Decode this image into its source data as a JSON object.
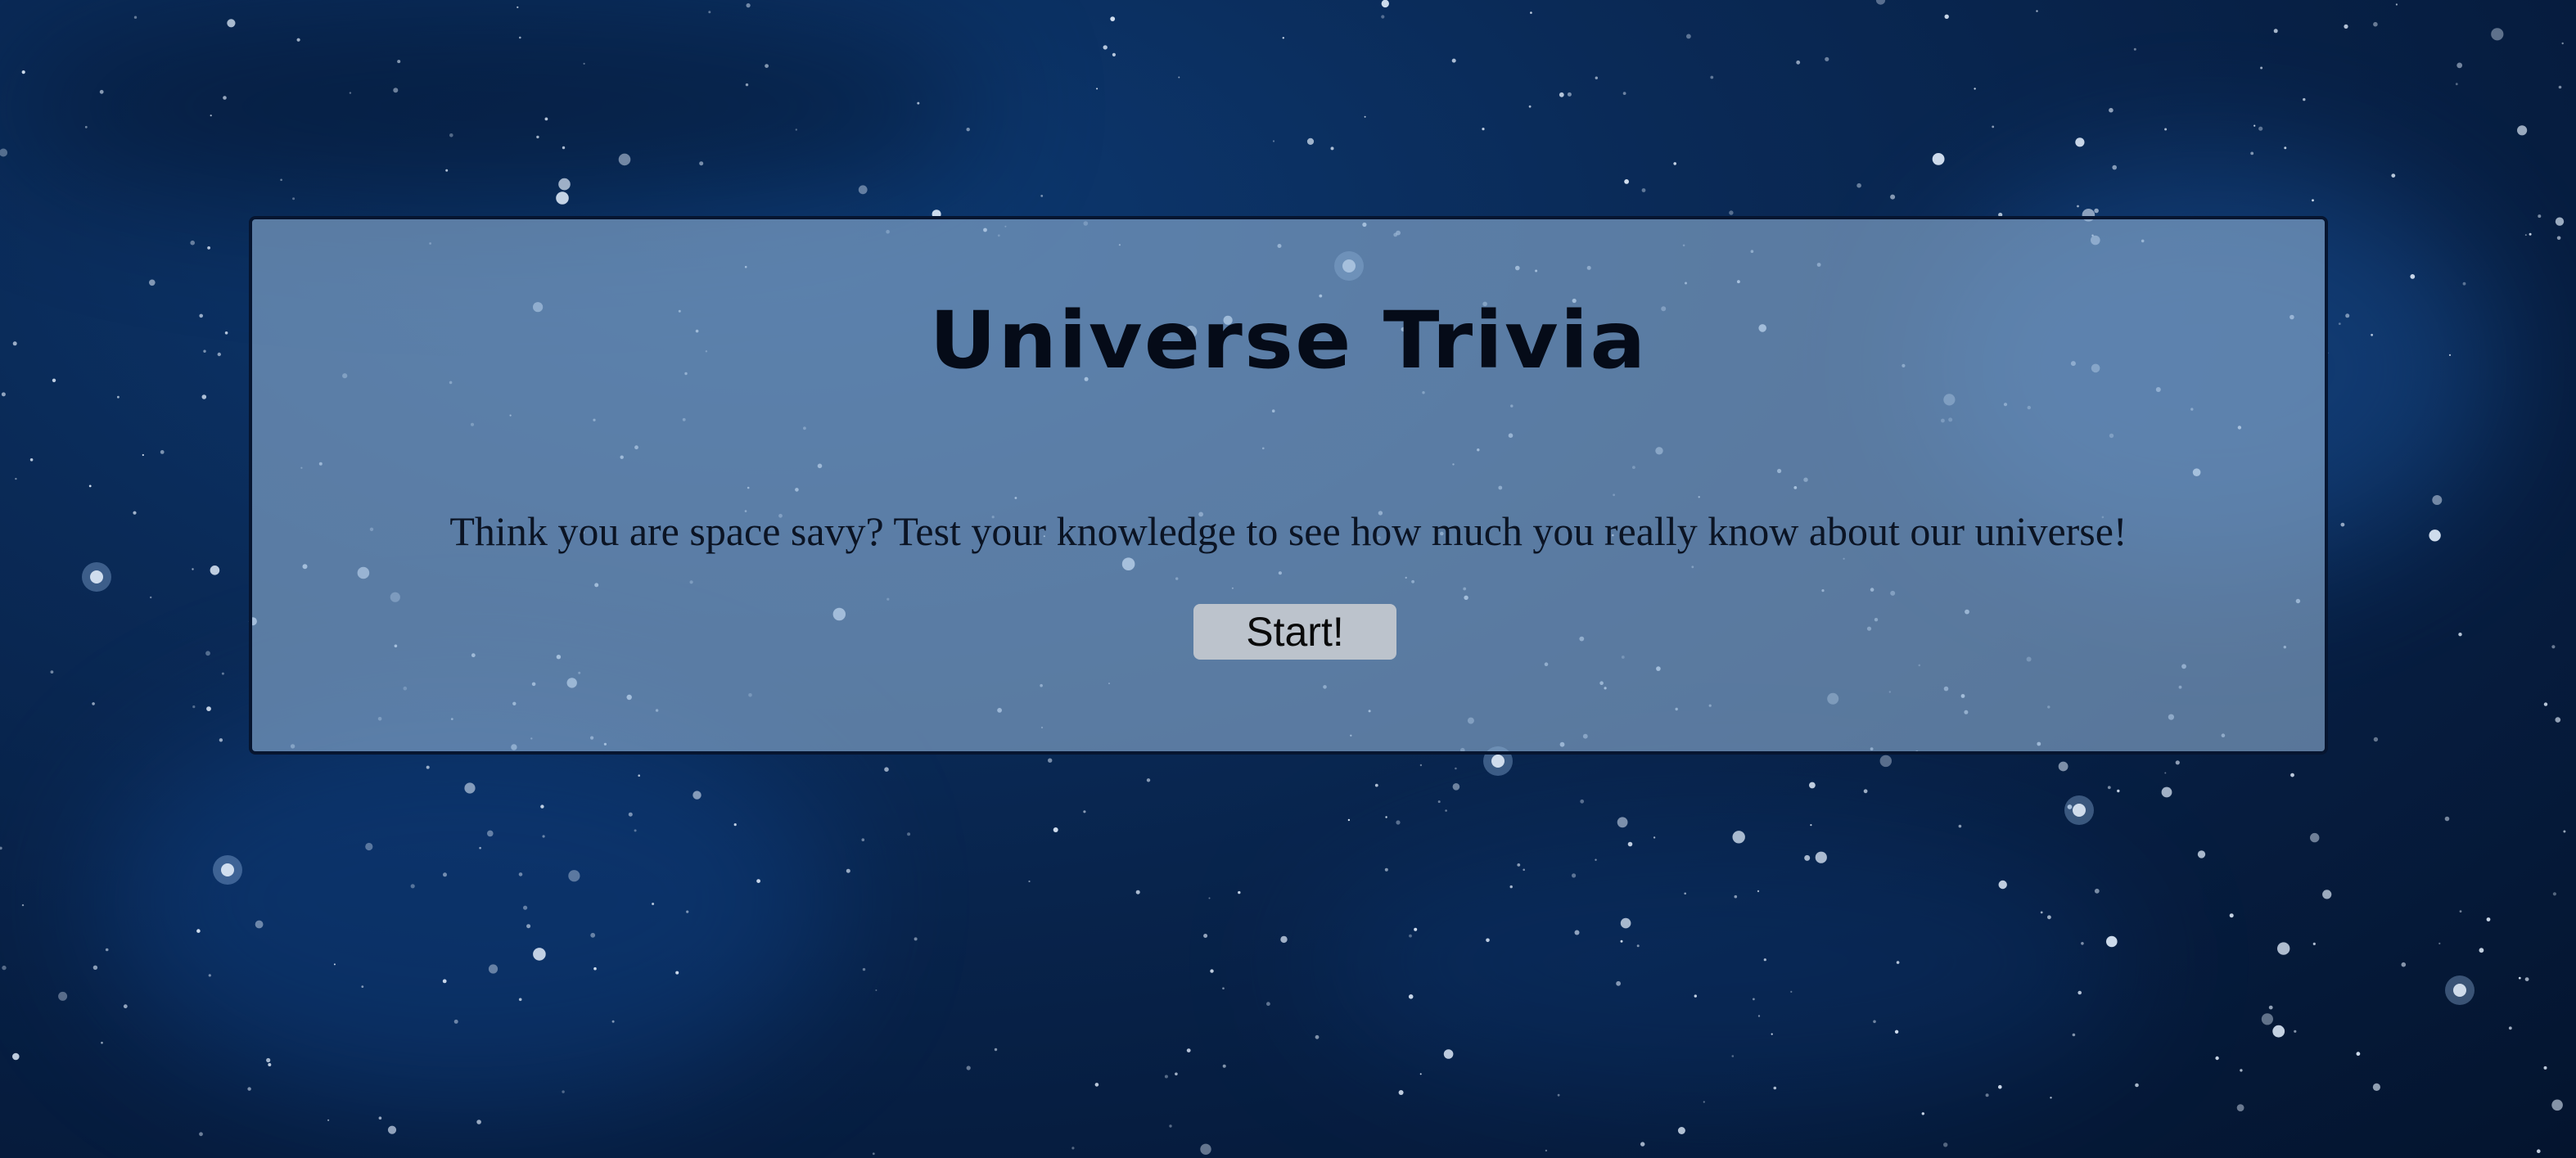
{
  "page": {
    "title": "Universe Trivia",
    "tagline": "Think you are space savy? Test your knowledge to see how much you really know about our universe!",
    "start_label": "Start!"
  },
  "colors": {
    "background": "#0a2a57",
    "panel": "#5f80a6",
    "panel_border": "#061530",
    "title_text": "#050b18",
    "button": "#bcc3cc"
  }
}
